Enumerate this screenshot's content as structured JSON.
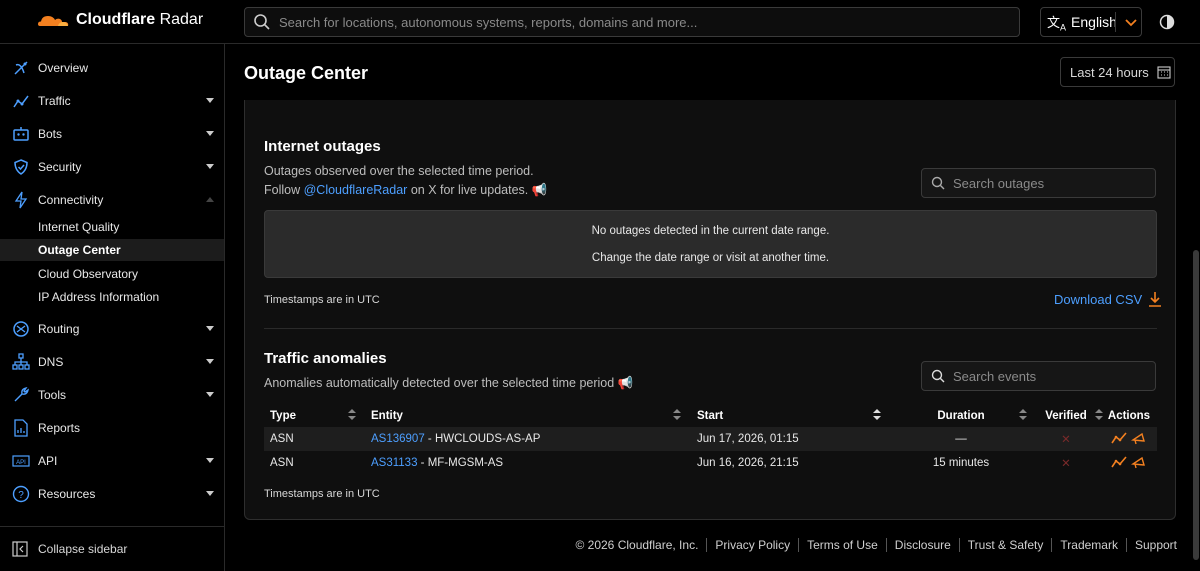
{
  "brand": {
    "name_bold": "Cloudflare",
    "name_light": "Radar",
    "accent": "#f38020"
  },
  "search": {
    "placeholder": "Search for locations, autonomous systems, reports, domains and more..."
  },
  "language": {
    "selected": "English"
  },
  "sidebar": {
    "items": [
      {
        "label": "Overview",
        "icon": "satellite-dish-icon"
      },
      {
        "label": "Traffic",
        "icon": "traffic-graph-icon"
      },
      {
        "label": "Bots",
        "icon": "robot-icon"
      },
      {
        "label": "Security",
        "icon": "shield-icon"
      },
      {
        "label": "Connectivity",
        "icon": "lightning-icon"
      },
      {
        "label": "Routing",
        "icon": "routing-icon"
      },
      {
        "label": "DNS",
        "icon": "dns-tree-icon"
      },
      {
        "label": "Tools",
        "icon": "wrench-icon"
      },
      {
        "label": "Reports",
        "icon": "report-chart-icon"
      },
      {
        "label": "API",
        "icon": "api-icon"
      },
      {
        "label": "Resources",
        "icon": "question-circle-icon"
      }
    ],
    "sub_items": [
      "Internet Quality",
      "Outage Center",
      "Cloud Observatory",
      "IP Address Information"
    ],
    "collapse_label": "Collapse sidebar"
  },
  "page": {
    "title": "Outage Center",
    "date_range": "Last 24 hours"
  },
  "outages": {
    "title": "Internet outages",
    "desc_line1": "Outages observed over the selected time period.",
    "desc_follow": "Follow",
    "desc_handle": "@CloudflareRadar",
    "desc_tail": "on X for live updates.",
    "search_placeholder": "Search outages",
    "empty_line1": "No outages detected in the current date range.",
    "empty_line2": "Change the date range or visit at another time.",
    "timestamps_note": "Timestamps are in UTC",
    "download_label": "Download CSV"
  },
  "anomalies": {
    "title": "Traffic anomalies",
    "desc": "Anomalies automatically detected over the selected time period",
    "search_placeholder": "Search events",
    "columns": [
      "Type",
      "Entity",
      "Start",
      "Duration",
      "Verified",
      "Actions"
    ],
    "rows": [
      {
        "type": "ASN",
        "asn": "AS136907",
        "name": "- HWCLOUDS-AS-AP",
        "start": "Jun 17, 2026, 01:15",
        "duration": "—"
      },
      {
        "type": "ASN",
        "asn": "AS31133",
        "name": "- MF-MGSM-AS",
        "start": "Jun 16, 2026, 21:15",
        "duration": "15 minutes"
      }
    ],
    "timestamps_note": "Timestamps are in UTC"
  },
  "footer": {
    "links": [
      "© 2026 Cloudflare, Inc.",
      "Privacy Policy",
      "Terms of Use",
      "Disclosure",
      "Trust & Safety",
      "Trademark",
      "Support"
    ]
  }
}
